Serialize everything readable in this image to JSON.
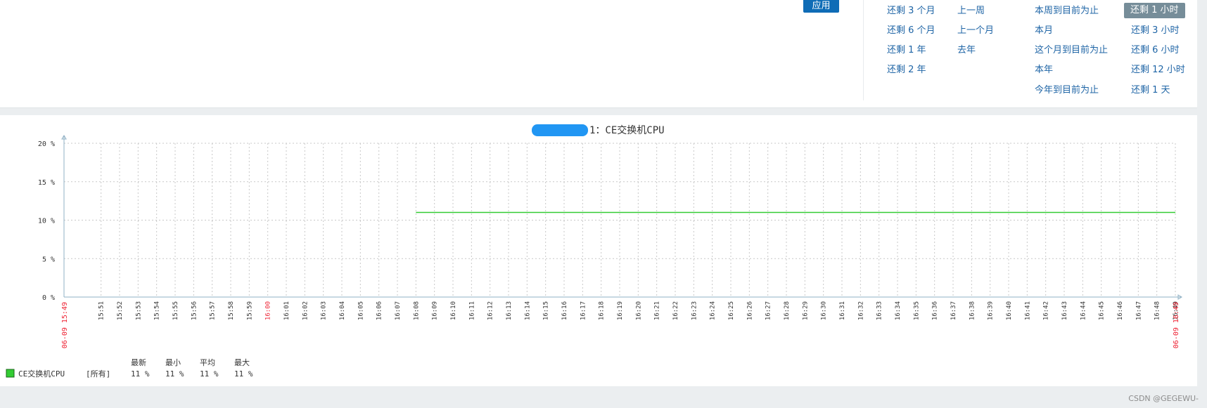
{
  "toolbar": {
    "apply_label": "应用"
  },
  "quick_ranges": {
    "col1": [
      "还剩 3 个月",
      "还剩 6 个月",
      "还剩 1 年",
      "还剩 2 年"
    ],
    "col2": [
      "上一周",
      "上一个月",
      "去年"
    ],
    "col3": [
      "本周到目前为止",
      "本月",
      "这个月到目前为止",
      "本年",
      "今年到目前为止"
    ],
    "col4": [
      "还剩 1 小时",
      "还剩 3 小时",
      "还剩 6 小时",
      "还剩 12 小时",
      "还剩 1 天"
    ],
    "selected": "还剩 1 小时"
  },
  "graph": {
    "title_suffix": "1：CE交换机CPU"
  },
  "chart_data": {
    "type": "line",
    "title": "1：CE交换机CPU",
    "ylim": [
      0,
      20
    ],
    "y_ticks": [
      "0 %",
      "5 %",
      "10 %",
      "15 %",
      "20 %"
    ],
    "x_start_label": "06-09 15:49",
    "x_end_label": "06-09 16:49",
    "x_ticks": [
      "15:51",
      "15:52",
      "15:53",
      "15:54",
      "15:55",
      "15:56",
      "15:57",
      "15:58",
      "15:59",
      "16:00",
      "16:01",
      "16:02",
      "16:03",
      "16:04",
      "16:05",
      "16:06",
      "16:07",
      "16:08",
      "16:09",
      "16:10",
      "16:11",
      "16:12",
      "16:13",
      "16:14",
      "16:15",
      "16:16",
      "16:17",
      "16:18",
      "16:19",
      "16:20",
      "16:21",
      "16:22",
      "16:23",
      "16:24",
      "16:25",
      "16:26",
      "16:27",
      "16:28",
      "16:29",
      "16:30",
      "16:31",
      "16:32",
      "16:33",
      "16:34",
      "16:35",
      "16:36",
      "16:37",
      "16:38",
      "16:39",
      "16:40",
      "16:41",
      "16:42",
      "16:43",
      "16:44",
      "16:45",
      "16:46",
      "16:47",
      "16:48",
      "16:49"
    ],
    "highlight_ticks": [
      "16:00"
    ],
    "grid": true,
    "series": [
      {
        "name": "CE交换机CPU",
        "color": "#33cc33",
        "x": [
          "16:08",
          "16:49"
        ],
        "values": [
          11,
          11
        ]
      }
    ]
  },
  "legend": {
    "headers": [
      "最新",
      "最小",
      "平均",
      "最大"
    ],
    "item": {
      "name": "CE交换机CPU",
      "scope": "[所有]",
      "values": [
        "11 %",
        "11 %",
        "11 %",
        "11 %"
      ],
      "color": "#33cc33"
    }
  },
  "footer": {
    "watermark": "CSDN @GEGEWU-"
  }
}
